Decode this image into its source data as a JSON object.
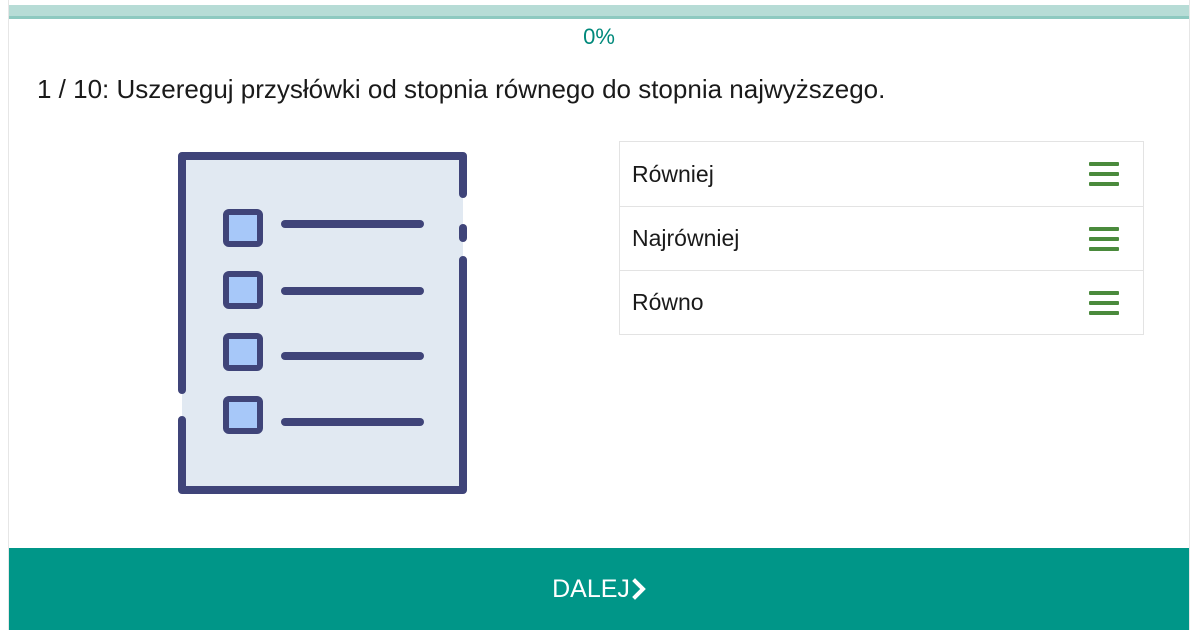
{
  "progress": {
    "label": "0%",
    "value": 0
  },
  "question": {
    "text": "1 / 10: Uszereguj przysłówki od stopnia równego do stopnia najwyższego."
  },
  "answers": [
    {
      "label": "Równiej",
      "icon": "drag-handle-icon"
    },
    {
      "label": "Najrówniej",
      "icon": "drag-handle-icon"
    },
    {
      "label": "Równo",
      "icon": "drag-handle-icon"
    }
  ],
  "illustration": {
    "icon": "checklist-icon"
  },
  "next_button": {
    "label": "DALEJ",
    "icon": "chevron-right-icon"
  },
  "colors": {
    "accent": "#009688",
    "progress_track": "#b7dcd6",
    "handle": "#4a8a3c",
    "illustration_outline": "#3f4479",
    "illustration_fill": "#e1e9f2",
    "checkbox_fill": "#a7c8f9"
  }
}
